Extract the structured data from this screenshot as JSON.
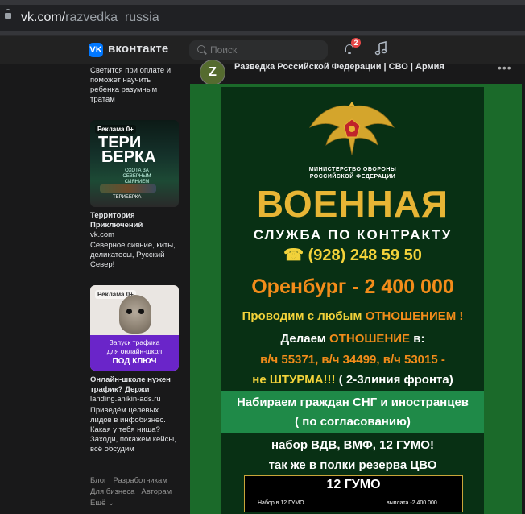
{
  "browser": {
    "url_domain": "vk.com/",
    "url_path": "razvedka_russia"
  },
  "header": {
    "logo_letter": "VK",
    "brand": "вконтакте",
    "search_placeholder": "Поиск",
    "notifications_count": "2"
  },
  "sidebar": {
    "ad1_text": "Светится при оплате и поможет научить ребенка разумным тратам",
    "ad2": {
      "badge": "Реклама 0+",
      "image_title_1": "ТЕРИ",
      "image_title_2": "БЕРКА",
      "image_caption": "ОХОТА ЗА СЕВЕРНЫМ СИЯНИЕМ",
      "image_brand": "ТЕРИБЕРКА",
      "title": "Территория Приключений",
      "domain": "vk.com",
      "description": "Северное сияние, киты, деликатесы, Русский Север!"
    },
    "ad3": {
      "badge": "Реклама 0+",
      "image_line1": "Запуск трафика",
      "image_line2": "для онлайн-школ",
      "image_line3": "ПОД КЛЮЧ",
      "title": "Онлайн-школе нужен трафик? Держи",
      "domain": "landing.anikin-ads.ru",
      "description": "Приведём целевых лидов в инфобизнес. Какая у тебя ниша? Заходи, покажем кейсы, всё обсудим"
    },
    "footer": {
      "blog": "Блог",
      "developers": "Разработчикам",
      "business": "Для бизнеса",
      "authors": "Авторам",
      "more": "Ещё ⌄"
    }
  },
  "post": {
    "avatar_letter": "Z",
    "community_name": "Разведка Российской Федерации | СВО | Армия",
    "more_label": "•••",
    "poster": {
      "ministry_line1": "МИНИСТЕРСТВО ОБОРОНЫ",
      "ministry_line2": "РОССИЙСКОЙ ФЕДЕРАЦИИ",
      "headline": "ВОЕННАЯ",
      "subhead": "СЛУЖБА ПО КОНТРАКТУ",
      "phone_icon": "☎",
      "phone": "(928) 248 59 50",
      "city_pay": "Оренбург - 2 400 000",
      "line1_a": "Проводим с любым ",
      "line1_b": "ОТНОШЕНИЕМ !",
      "line2_a": "Делаем ",
      "line2_b": "ОТНОШЕНИЕ",
      "line2_c": " в:",
      "line3": "в/ч 55371,  в/ч 34499,  в/ч 53015 -",
      "line4_a": "не ШТУРМА!!!",
      "line4_b": " ( 2-3линия фронта)",
      "cis_line1": "Набираем граждан СНГ и иностранцев",
      "cis_line2": "( по согласованию)",
      "line5": "набор   ВДВ,  ВМФ,  12 ГУМО!",
      "line6": "так же в полки резерва ЦВО",
      "gumo_title": "12 ГУМО",
      "gumo_left": "Набор в 12 ГУМО",
      "gumo_right": "выплата -2.400 000"
    }
  },
  "colors": {
    "accent": "#0077ff",
    "poster_green": "#1b6a2a",
    "gold": "#e7b535",
    "orange": "#f28c1a"
  }
}
